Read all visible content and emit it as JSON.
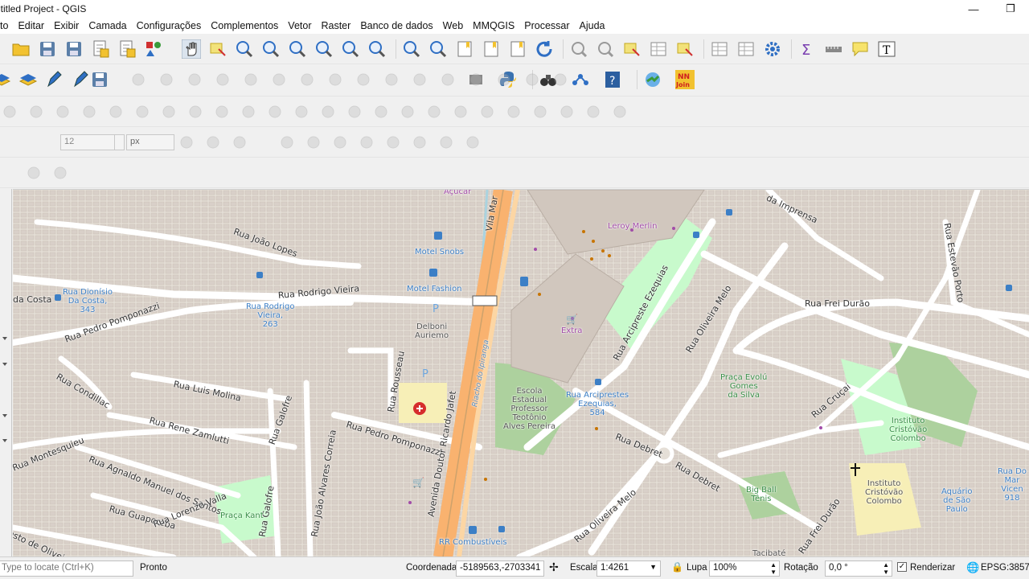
{
  "window": {
    "title": "ntitled Project - QGIS",
    "minimize_glyph": "—",
    "restore_glyph": "❐"
  },
  "menu": [
    "to",
    "Editar",
    "Exibir",
    "Camada",
    "Configurações",
    "Complementos",
    "Vetor",
    "Raster",
    "Banco de dados",
    "Web",
    "MMQGIS",
    "Processar",
    "Ajuda"
  ],
  "toolbar_icons": {
    "row1": [
      "open-folder-icon",
      "save-icon",
      "save-as-icon",
      "print-layout-icon",
      "layout-manager-icon",
      "style-manager-icon",
      "pan-hand-icon",
      "pan-to-selection-icon",
      "zoom-in-icon",
      "zoom-out-icon",
      "zoom-native-icon",
      "zoom-full-icon",
      "zoom-to-selection-icon",
      "zoom-to-layer-icon",
      "zoom-last-icon",
      "zoom-next-icon",
      "new-bookmark-icon",
      "show-bookmarks-icon",
      "spatial-bookmark-icon",
      "refresh-icon",
      "identify-icon",
      "run-action-icon",
      "select-features-icon",
      "attribute-table-icon",
      "deselect-icon",
      "field-calculator-icon",
      "statistics-icon",
      "settings-cog-icon",
      "sum-icon",
      "measure-icon",
      "map-tips-icon",
      "text-annotation-icon"
    ],
    "row2": [
      "new-layer-icon",
      "new-geopackage-icon",
      "digitize-icon",
      "edit-pencil-icon",
      "save-edits-icon",
      "plugin-manager-icon",
      "python-console-icon",
      "binoculars-icon",
      "network-icon",
      "help-icon",
      "quickmapservices-icon",
      "nnjoin-icon"
    ]
  },
  "nnjoin_label": "NN\nJoin",
  "label_toolbar": {
    "font_size_value": "12",
    "unit_value": "px"
  },
  "map": {
    "street_labels": [
      "da Costa",
      "Rua João Lopes",
      "Rua Rodrigo Vieira",
      "Rua Pedro Pomponazzi",
      "Rua Condillac",
      "Rua Luis Molina",
      "Rua Rene Zamlutti",
      "Rua Montesquieu",
      "Rua Agnaldo Manuel dos Santos",
      "Rua Guaporeba",
      "Rua Lorenzo Valla",
      "esto de Oliveira",
      "Rua Galofre",
      "Rua Galofre",
      "Rua João Alvares Correia",
      "Rua Rousseau",
      "Rua Pedro Pomponazzi",
      "Avenida Doutor Ricardo Jafet",
      "Rua Arcipreste Ezequias",
      "Rua Oliveira Melo",
      "Rua Oliveira Melo",
      "Rua Debret",
      "Rua Debret",
      "Rua Frei Durão",
      "Rua Frei Durão",
      "Rua Cruçai",
      "da Imprensa",
      "Rua Estevão Porto",
      "Riacho do Ipiranga",
      "Vila Mar"
    ],
    "pois": [
      {
        "name": "Açúcar",
        "kind": "purple"
      },
      {
        "name": "Motel Snobs",
        "kind": "blue"
      },
      {
        "name": "Motel Fashion",
        "kind": "blue"
      },
      {
        "name": "Rua Dionísio\nDa Costa,\n343",
        "kind": "blue"
      },
      {
        "name": "Rua Rodrigo\nVieira,\n263",
        "kind": "blue"
      },
      {
        "name": "Delboni\nAuriemo",
        "kind": "gray"
      },
      {
        "name": "Leroy Merlin",
        "kind": "purple"
      },
      {
        "name": "Extra",
        "kind": "purple"
      },
      {
        "name": "Escola\nEstadual\nProfessor\nTeotônio\nAlves Pereira",
        "kind": "gray"
      },
      {
        "name": "Rua Arciprestes\nEzequias,\n584",
        "kind": "blue"
      },
      {
        "name": "Praça Evolú\nGomes\nda Silva",
        "kind": "green"
      },
      {
        "name": "Instituto\nCristóvão\nColombo",
        "kind": "green"
      },
      {
        "name": "Instituto\nCristóvão\nColombo",
        "kind": "gray"
      },
      {
        "name": "Big Ball\nTênis",
        "kind": "green"
      },
      {
        "name": "Aquário\nde São\nPaulo",
        "kind": "blue"
      },
      {
        "name": "Praça Kant",
        "kind": "green"
      },
      {
        "name": "RR Combustíveis",
        "kind": "blue"
      },
      {
        "name": "Rua Do\nMar\nVicen\n918",
        "kind": "blue"
      },
      {
        "name": "Tacibaté",
        "kind": "gray"
      }
    ]
  },
  "status": {
    "locator_placeholder": "Type to locate (Ctrl+K)",
    "ready": "Pronto",
    "coordinate_label": "Coordenada",
    "coordinate_value": "-5189563,-2703341",
    "scale_label": "Escala",
    "scale_value": "1:4261",
    "magnifier_label": "Lupa",
    "magnifier_value": "100%",
    "rotation_label": "Rotação",
    "rotation_value": "0,0 °",
    "render_label": "Renderizar",
    "render_checked": true,
    "crs": "EPSG:3857"
  },
  "colors": {
    "map_background": "#e5dfd7",
    "building": "#d9d0c9",
    "road": "#ffffff",
    "trunk_road": "#f9b26f",
    "park": "#c8facc",
    "poi_blue": "#3c7fc6",
    "poi_purple": "#a24ca8"
  }
}
